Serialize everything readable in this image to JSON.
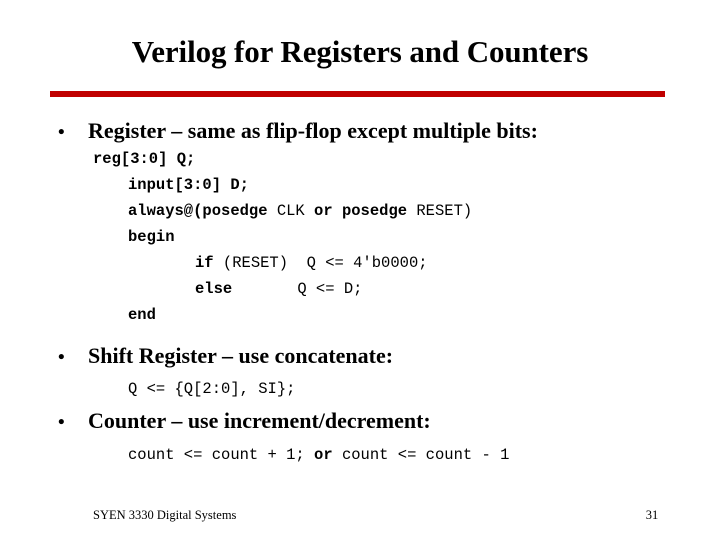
{
  "slide": {
    "title": "Verilog for Registers and Counters",
    "accent_color": "#C00000",
    "background_color": "#FFFFFF",
    "text_color": "#000000"
  },
  "bullets": [
    {
      "marker": "•",
      "text": "Register – same as flip-flop except multiple bits:"
    },
    {
      "marker": "•",
      "text": "Shift Register – use concatenate:"
    },
    {
      "marker": "•",
      "text": "Counter – use increment/decrement:"
    }
  ],
  "code_register": [
    {
      "indent": "",
      "keyword": "reg[3:0]",
      "rest": " Q;"
    },
    {
      "indent": "  ",
      "keyword": "input[3:0]",
      "rest": " D;"
    },
    {
      "indent": "  ",
      "keyword": "always@(posedge",
      "rest": " CLK ",
      "keyword2": "or posedge",
      "rest2": " RESET)"
    },
    {
      "indent": "  ",
      "keyword": "begin",
      "rest": ""
    },
    {
      "indent": "       ",
      "keyword": "if",
      "rest": " (RESET)  Q <= 4'b0000;"
    },
    {
      "indent": "       ",
      "keyword": "else",
      "rest": "       Q <= D;"
    },
    {
      "indent": "  ",
      "keyword": "end",
      "rest": ""
    }
  ],
  "code_shift": {
    "text": "Q <= {Q[2:0], SI};"
  },
  "code_counter": {
    "part1": "count <= count + 1;",
    "keyword": " or ",
    "part2": "count <= count - 1"
  },
  "footer": {
    "course": "SYEN 3330 Digital Systems",
    "page_number": "31"
  }
}
